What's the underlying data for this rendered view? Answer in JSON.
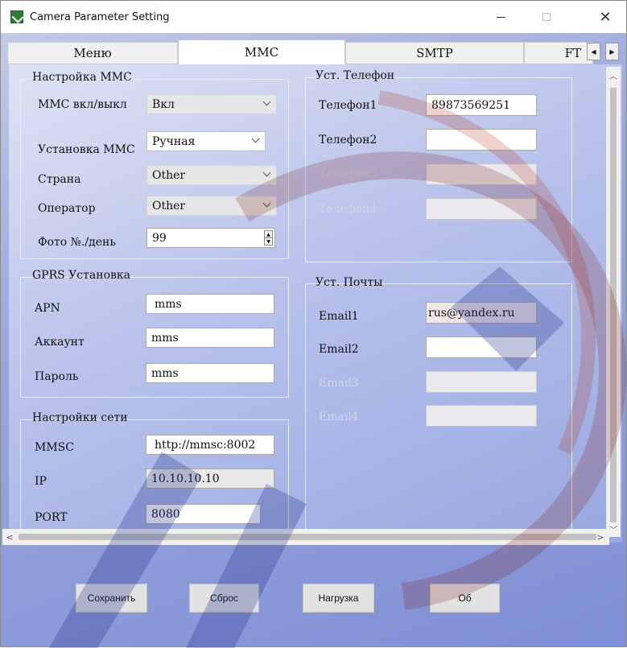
{
  "window": {
    "title": "Camera Parameter Setting"
  },
  "tabs": [
    {
      "label": "Меню"
    },
    {
      "label": "MMC"
    },
    {
      "label": "SMTP"
    },
    {
      "label": "FT"
    }
  ],
  "mms_settings": {
    "title": "Настройка MMC",
    "rows": [
      {
        "label": "MMC вкл/выкл",
        "value": "Вкл"
      },
      {
        "label": "Установка MMC",
        "value": "Ручная"
      },
      {
        "label": "Страна",
        "value": "Other"
      },
      {
        "label": "Оператор",
        "value": "Other"
      },
      {
        "label": "Фото №./день",
        "value": "99"
      }
    ]
  },
  "gprs": {
    "title": "GPRS Установка",
    "rows": [
      {
        "label": "APN",
        "value": "mms"
      },
      {
        "label": "Аккаунт",
        "value": "mms"
      },
      {
        "label": "Пароль",
        "value": "mms"
      }
    ]
  },
  "network": {
    "title": "Настройки сети",
    "rows": [
      {
        "label": "MMSC",
        "value": "http://mmsc:8002"
      },
      {
        "label": "IP",
        "value": "10.10.10.10"
      },
      {
        "label": "PORT",
        "value": "8080"
      }
    ]
  },
  "phone": {
    "title": "Уст. Телефон",
    "rows": [
      {
        "label": "Телефон1",
        "value": "89873569251"
      },
      {
        "label": "Телефон2",
        "value": ""
      },
      {
        "label": "Телефон3",
        "value": ""
      },
      {
        "label": "Телефон4",
        "value": ""
      }
    ]
  },
  "email": {
    "title": "Уст. Почты",
    "rows": [
      {
        "label": "Email1",
        "value": "rus@yandex.ru"
      },
      {
        "label": "Email2",
        "value": ""
      },
      {
        "label": "Email3",
        "value": ""
      },
      {
        "label": "Email4",
        "value": ""
      }
    ]
  },
  "buttons": {
    "save": "Сохранить",
    "reset": "Сброс",
    "load": "Нагрузка",
    "about": "Об"
  }
}
